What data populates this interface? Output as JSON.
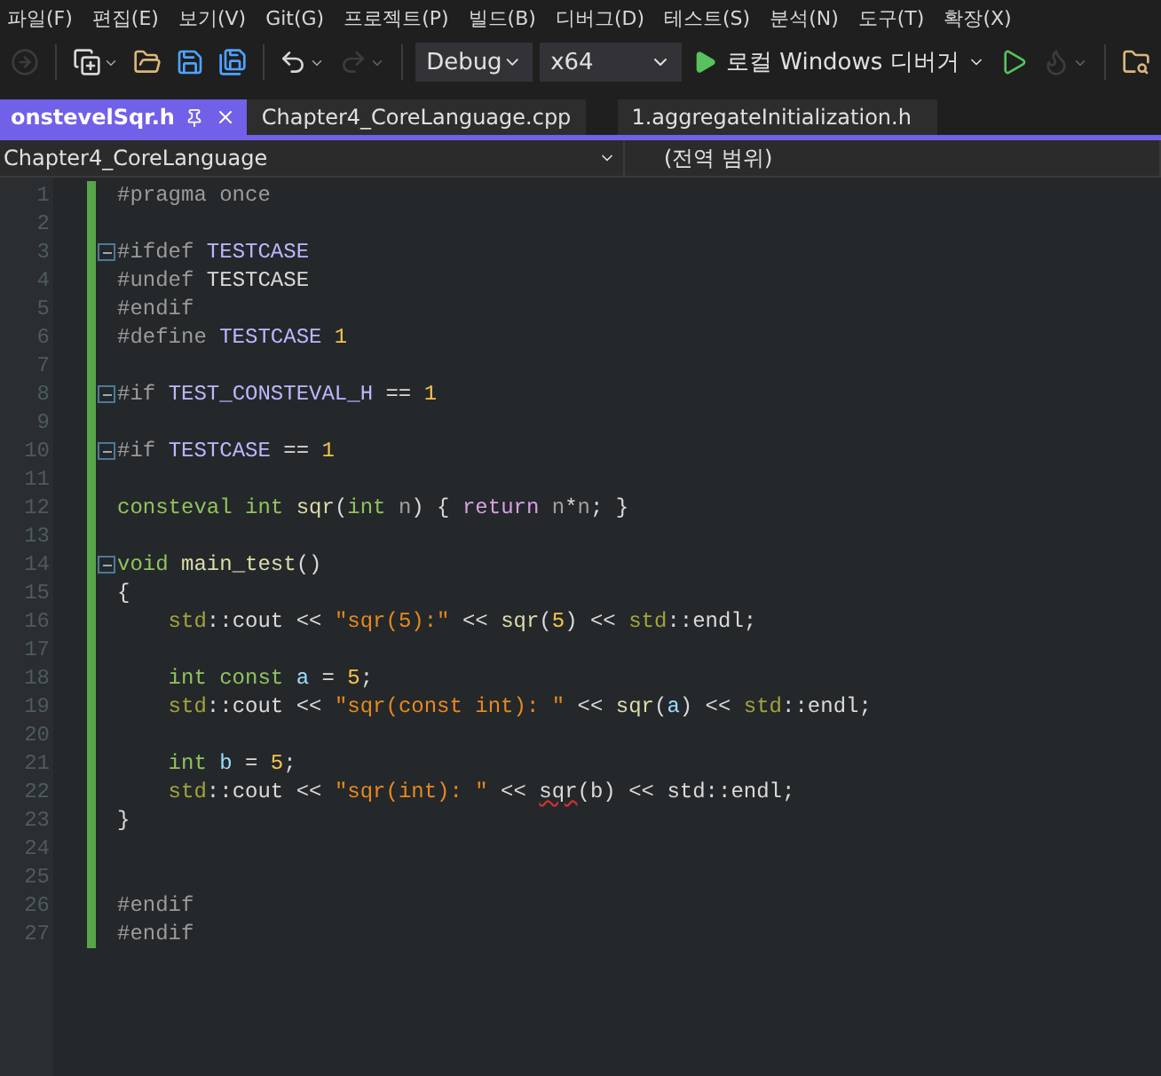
{
  "menu": [
    "파일(F)",
    "편집(E)",
    "보기(V)",
    "Git(G)",
    "프로젝트(P)",
    "빌드(B)",
    "디버그(D)",
    "테스트(S)",
    "분석(N)",
    "도구(T)",
    "확장(X)"
  ],
  "toolbar": [
    {
      "kind": "forward",
      "disabled": true
    },
    {
      "kind": "separator"
    },
    {
      "kind": "new",
      "disabled": false,
      "has_menu": true
    },
    {
      "kind": "open",
      "disabled": false
    },
    {
      "kind": "save",
      "disabled": false
    },
    {
      "kind": "save_all",
      "disabled": false
    },
    {
      "kind": "separator"
    },
    {
      "kind": "undo",
      "disabled": false,
      "has_menu": true
    },
    {
      "kind": "redo",
      "disabled": true,
      "has_menu": true
    },
    {
      "kind": "separator"
    },
    {
      "kind": "combo",
      "value": "Debug"
    },
    {
      "kind": "combo",
      "value": "x64",
      "wide": true
    },
    {
      "kind": "start",
      "label": "로컬 Windows 디버거",
      "has_menu": true
    },
    {
      "kind": "run",
      "disabled": false
    },
    {
      "kind": "hot_reload",
      "disabled": true,
      "has_menu": true
    },
    {
      "kind": "separator"
    },
    {
      "kind": "find_folder",
      "disabled": false
    }
  ],
  "tabs": [
    {
      "label": "onstevelSqr.h",
      "selected": true
    },
    {
      "label": "Chapter4_CoreLanguage.cpp",
      "selected": false
    },
    {
      "label": "1.aggregateInitialization.h",
      "selected": false
    }
  ],
  "navigation": {
    "project": "Chapter4_CoreLanguage",
    "scope": "(전역 범위)"
  },
  "editor": {
    "lines": [
      {
        "number": "1",
        "changed": true,
        "tokens": [
          {
            "kind": "pp",
            "text": "#pragma once"
          }
        ]
      },
      {
        "number": "2",
        "changed": true
      },
      {
        "number": "3",
        "fold": true,
        "changed": true,
        "tokens": [
          {
            "kind": "pp",
            "text": "#ifdef "
          },
          {
            "kind": "macro",
            "text": "TESTCASE"
          }
        ]
      },
      {
        "number": "4",
        "changed": true,
        "tokens": [
          {
            "kind": "pp",
            "text": "#undef "
          },
          {
            "kind": "plain",
            "text": "TESTCASE"
          }
        ]
      },
      {
        "number": "5",
        "changed": true,
        "tokens": [
          {
            "kind": "pp",
            "text": "#endif"
          }
        ]
      },
      {
        "number": "6",
        "changed": true,
        "tokens": [
          {
            "kind": "pp",
            "text": "#define "
          },
          {
            "kind": "macro",
            "text": "TESTCASE"
          },
          {
            "kind": "num",
            "text": " 1"
          }
        ]
      },
      {
        "number": "7",
        "changed": true
      },
      {
        "number": "8",
        "fold": true,
        "changed": true,
        "tokens": [
          {
            "kind": "pp",
            "text": "#if "
          },
          {
            "kind": "macro",
            "text": "TEST_CONSTEVAL_H"
          },
          {
            "kind": "plain",
            "text": " == "
          },
          {
            "kind": "num",
            "text": "1"
          }
        ]
      },
      {
        "number": "9",
        "changed": true
      },
      {
        "number": "10",
        "fold": true,
        "changed": true,
        "tokens": [
          {
            "kind": "pp",
            "text": "#if "
          },
          {
            "kind": "macro",
            "text": "TESTCASE"
          },
          {
            "kind": "plain",
            "text": " == "
          },
          {
            "kind": "num",
            "text": "1"
          }
        ]
      },
      {
        "number": "11",
        "changed": true
      },
      {
        "number": "12",
        "changed": true,
        "tokens": [
          {
            "kind": "kw",
            "text": "consteval int "
          },
          {
            "kind": "fn",
            "text": "sqr"
          },
          {
            "kind": "plain",
            "text": "("
          },
          {
            "kind": "kw",
            "text": "int "
          },
          {
            "kind": "param",
            "text": "n"
          },
          {
            "kind": "plain",
            "text": ") { "
          },
          {
            "kind": "ctl",
            "text": "return "
          },
          {
            "kind": "param",
            "text": "n"
          },
          {
            "kind": "plain",
            "text": "*"
          },
          {
            "kind": "param",
            "text": "n"
          },
          {
            "kind": "plain",
            "text": "; }"
          }
        ]
      },
      {
        "number": "13",
        "changed": true
      },
      {
        "number": "14",
        "fold": true,
        "changed": true,
        "tokens": [
          {
            "kind": "kw",
            "text": "void "
          },
          {
            "kind": "fn",
            "text": "main_test"
          },
          {
            "kind": "plain",
            "text": "()"
          }
        ]
      },
      {
        "number": "15",
        "changed": true,
        "tokens": [
          {
            "kind": "plain",
            "text": "{"
          }
        ]
      },
      {
        "number": "16",
        "changed": true,
        "tokens": [
          {
            "kind": "ns",
            "text": "    std"
          },
          {
            "kind": "plain",
            "text": "::cout << "
          },
          {
            "kind": "str",
            "text": "\"sqr(5):\""
          },
          {
            "kind": "plain",
            "text": " << "
          },
          {
            "kind": "fn",
            "text": "sqr"
          },
          {
            "kind": "plain",
            "text": "("
          },
          {
            "kind": "num",
            "text": "5"
          },
          {
            "kind": "plain",
            "text": ") << "
          },
          {
            "kind": "ns",
            "text": "std"
          },
          {
            "kind": "plain",
            "text": "::endl;"
          }
        ]
      },
      {
        "number": "17",
        "changed": true
      },
      {
        "number": "18",
        "changed": true,
        "tokens": [
          {
            "kind": "kw",
            "text": "    int const "
          },
          {
            "kind": "var",
            "text": "a"
          },
          {
            "kind": "plain",
            "text": " = "
          },
          {
            "kind": "num",
            "text": "5"
          },
          {
            "kind": "plain",
            "text": ";"
          }
        ]
      },
      {
        "number": "19",
        "changed": true,
        "tokens": [
          {
            "kind": "ns",
            "text": "    std"
          },
          {
            "kind": "plain",
            "text": "::cout << "
          },
          {
            "kind": "str",
            "text": "\"sqr(const int): \""
          },
          {
            "kind": "plain",
            "text": " << "
          },
          {
            "kind": "fn",
            "text": "sqr"
          },
          {
            "kind": "plain",
            "text": "("
          },
          {
            "kind": "var",
            "text": "a"
          },
          {
            "kind": "plain",
            "text": ") << "
          },
          {
            "kind": "ns",
            "text": "std"
          },
          {
            "kind": "plain",
            "text": "::endl;"
          }
        ]
      },
      {
        "number": "20",
        "changed": true
      },
      {
        "number": "21",
        "changed": true,
        "tokens": [
          {
            "kind": "kw",
            "text": "    int "
          },
          {
            "kind": "var",
            "text": "b"
          },
          {
            "kind": "plain",
            "text": " = "
          },
          {
            "kind": "num",
            "text": "5"
          },
          {
            "kind": "plain",
            "text": ";"
          }
        ]
      },
      {
        "number": "22",
        "changed": true,
        "tokens": [
          {
            "kind": "ns",
            "text": "    std"
          },
          {
            "kind": "plain",
            "text": "::cout << "
          },
          {
            "kind": "str",
            "text": "\"sqr(int): \""
          },
          {
            "kind": "plain",
            "text": " << "
          },
          {
            "kind": "err",
            "text": "sqr"
          },
          {
            "kind": "plain",
            "text": "(b) << std::endl;"
          }
        ]
      },
      {
        "number": "23",
        "changed": true,
        "tokens": [
          {
            "kind": "plain",
            "text": "}"
          }
        ]
      },
      {
        "number": "24",
        "changed": true
      },
      {
        "number": "25",
        "changed": true
      },
      {
        "number": "26",
        "changed": true,
        "tokens": [
          {
            "kind": "pp",
            "text": "#endif"
          }
        ]
      },
      {
        "number": "27",
        "changed": true,
        "tokens": [
          {
            "kind": "pp",
            "text": "#endif"
          }
        ]
      }
    ]
  }
}
